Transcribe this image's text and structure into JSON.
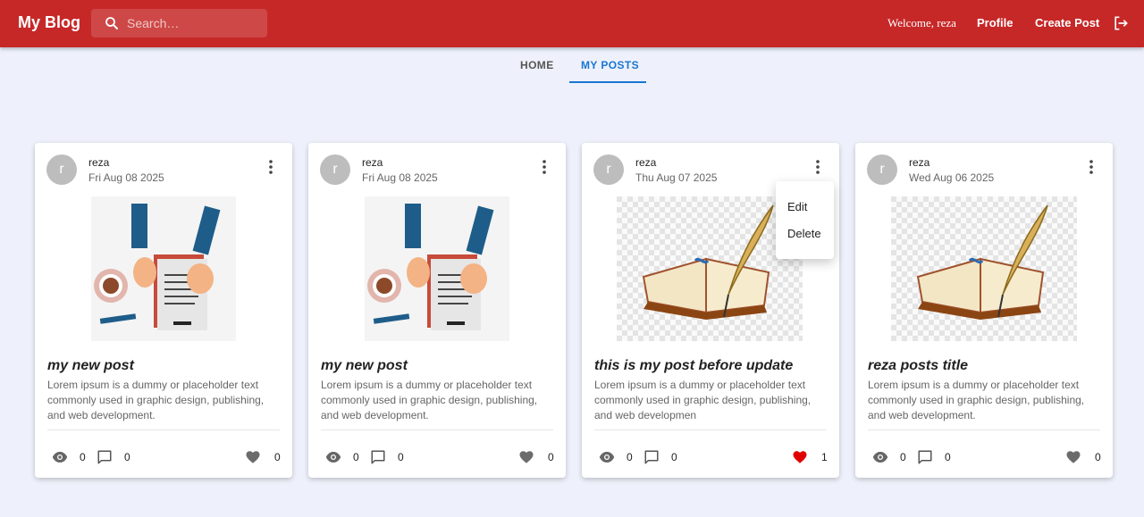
{
  "header": {
    "brand": "My Blog",
    "search_placeholder": "Search…",
    "welcome": "Welcome, reza",
    "profile_label": "Profile",
    "create_label": "Create Post",
    "accent_color": "#c62828"
  },
  "tabs": [
    {
      "label": "HOME",
      "active": false
    },
    {
      "label": "MY POSTS",
      "active": true
    }
  ],
  "posts": [
    {
      "avatar": "r",
      "author": "reza",
      "date": "Fri Aug 08 2025",
      "image": "desk-writing-illustration",
      "title": "my new post",
      "body": "Lorem ipsum is a dummy or placeholder text commonly used in graphic design, publishing, and web development.",
      "views": "0",
      "comments": "0",
      "likes": "0",
      "liked": false
    },
    {
      "avatar": "r",
      "author": "reza",
      "date": "Fri Aug 08 2025",
      "image": "desk-writing-illustration",
      "title": "my new post",
      "body": "Lorem ipsum is a dummy or placeholder text commonly used in graphic design, publishing, and web development.",
      "views": "0",
      "comments": "0",
      "likes": "0",
      "liked": false
    },
    {
      "avatar": "r",
      "author": "reza",
      "date": "Thu Aug 07 2025",
      "image": "book-and-quill",
      "title": "this is my post before update",
      "body": "Lorem ipsum is a dummy or placeholder text commonly used in graphic design, publishing, and web developmen",
      "views": "0",
      "comments": "0",
      "likes": "1",
      "liked": true
    },
    {
      "avatar": "r",
      "author": "reza",
      "date": "Wed Aug 06 2025",
      "image": "book-and-quill",
      "title": "reza posts title",
      "body": "Lorem ipsum is a dummy or placeholder text commonly used in graphic design, publishing, and web development.",
      "views": "0",
      "comments": "0",
      "likes": "0",
      "liked": false
    }
  ],
  "menu": {
    "edit": "Edit",
    "delete": "Delete"
  },
  "colors": {
    "liked_heart": "#e10000",
    "unliked_heart": "#6b6b6b",
    "tab_active": "#1976d2"
  }
}
